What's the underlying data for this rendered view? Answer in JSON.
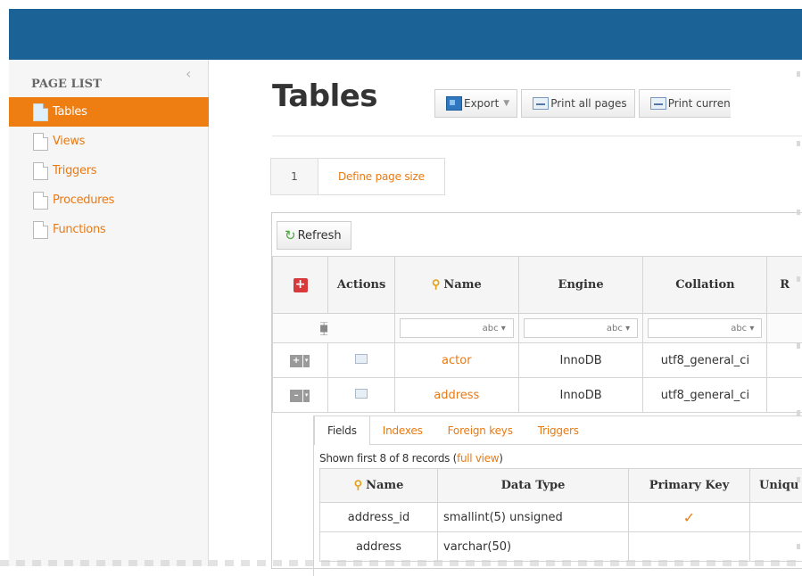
{
  "sidebar": {
    "title": "PAGE LIST",
    "collapse_icon": "chevron-left-icon",
    "items": [
      {
        "label": "Tables",
        "active": true
      },
      {
        "label": "Views",
        "active": false
      },
      {
        "label": "Triggers",
        "active": false
      },
      {
        "label": "Procedures",
        "active": false
      },
      {
        "label": "Functions",
        "active": false
      }
    ]
  },
  "header": {
    "title": "Tables",
    "toolbar": {
      "export_label": "Export",
      "print_all_label": "Print all pages",
      "print_current_label": "Print curren"
    }
  },
  "pager": {
    "page_number": "1",
    "define_label": "Define page size"
  },
  "grid": {
    "refresh_label": "Refresh",
    "columns": [
      "Actions",
      "Name",
      "Engine",
      "Collation",
      "R"
    ],
    "filter_placeholder": "abc",
    "rows": [
      {
        "name": "actor",
        "engine": "InnoDB",
        "collation": "utf8_general_ci",
        "expanded": false
      },
      {
        "name": "address",
        "engine": "InnoDB",
        "collation": "utf8_general_ci",
        "expanded": true
      }
    ]
  },
  "detail": {
    "tabs": [
      "Fields",
      "Indexes",
      "Foreign keys",
      "Triggers"
    ],
    "records_text": "Shown first 8 of 8 records (",
    "records_link": "full view",
    "records_close": ")",
    "columns": [
      "Name",
      "Data Type",
      "Primary Key",
      "Uniqu"
    ],
    "rows": [
      {
        "name": "address_id",
        "data_type": "smallint(5) unsigned",
        "primary_key": "✓"
      },
      {
        "name": "address",
        "data_type": "varchar(50)",
        "primary_key": ""
      }
    ]
  },
  "colors": {
    "header_bar": "#1b6397",
    "accent": "#ee7d12",
    "link": "#e87a13"
  }
}
